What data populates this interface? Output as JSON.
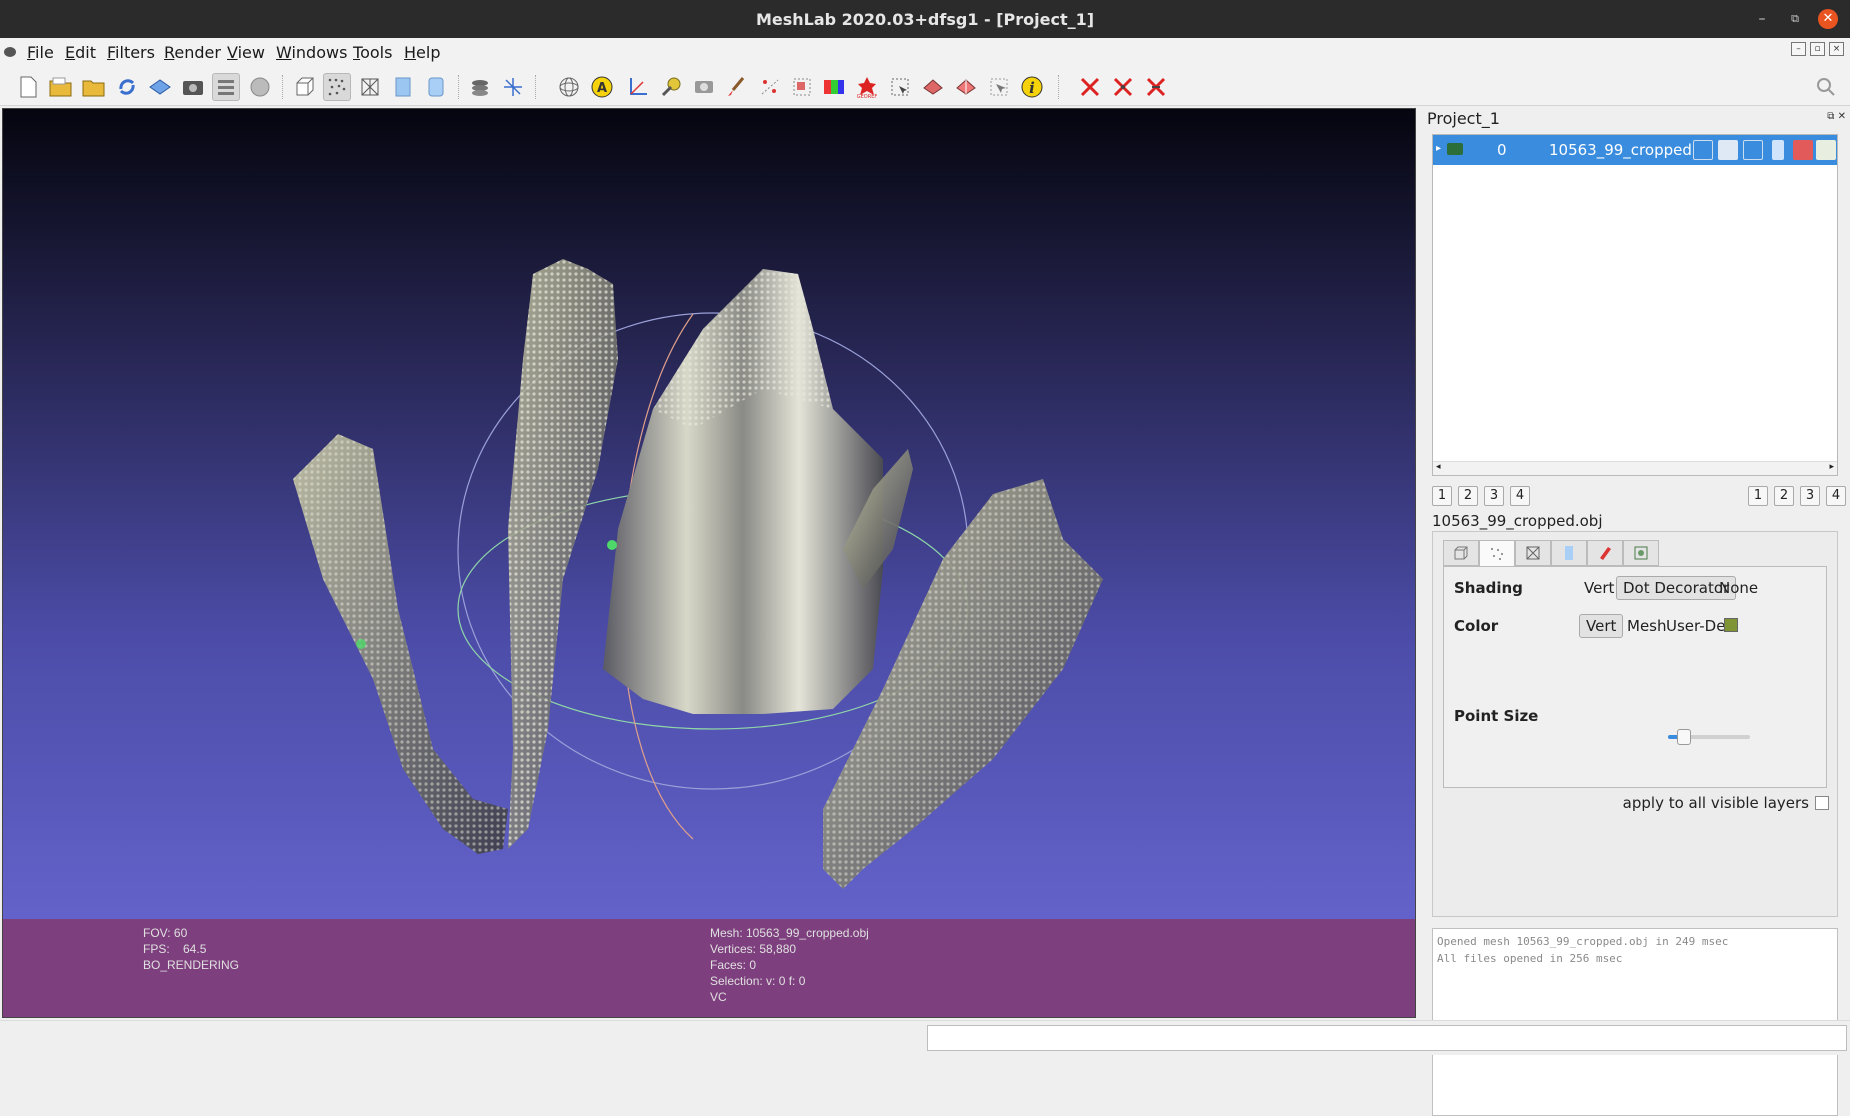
{
  "window": {
    "title": "MeshLab 2020.03+dfsg1 - [Project_1]",
    "minimize_glyph": "–",
    "restore_glyph": "⧉",
    "close_glyph": "✕"
  },
  "menubar": {
    "items": [
      {
        "label_u": "F",
        "label_rest": "ile"
      },
      {
        "label_u": "E",
        "label_rest": "dit"
      },
      {
        "label_u": "F",
        "label_rest": "ilters"
      },
      {
        "label_u": "R",
        "label_rest": "ender"
      },
      {
        "label_u": "V",
        "label_rest": "iew"
      },
      {
        "label_u": "W",
        "label_rest": "indows"
      },
      {
        "label_u": "T",
        "label_rest": "ools"
      },
      {
        "label_u": "H",
        "label_rest": "elp"
      }
    ]
  },
  "toolbar": {
    "icons": [
      "new-project-icon",
      "open-project-icon",
      "open-mesh-icon",
      "reload-icon",
      "import-raster-icon",
      "snapshot-icon",
      "layers-icon",
      "mesh-render-icon",
      "bounding-box-icon",
      "points-icon",
      "wireframe-icon",
      "flat-icon",
      "smooth-icon",
      "texture-icon",
      "axis-icon",
      "trackball-icon",
      "annotation-icon",
      "measure-icon",
      "pick-points-icon",
      "raster-icon",
      "paint-icon",
      "select-vertices-icon",
      "select-faces-icon",
      "color-icon",
      "georef-icon",
      "select-icon",
      "align-icon",
      "manipulator-icon",
      "point-picker-icon",
      "info-icon",
      "delete-icon",
      "delete-faces-icon",
      "delete-vertices-icon",
      "search-icon"
    ]
  },
  "viewport": {
    "info_left": [
      "FOV: 60",
      "FPS:    64.5",
      "BO_RENDERING"
    ],
    "info_center": [
      "Mesh: 10563_99_cropped.obj",
      "Vertices: 58,880",
      "Faces: 0",
      "Selection: v: 0 f: 0",
      "VC"
    ]
  },
  "panel": {
    "title": "Project_1",
    "layer": {
      "index": "0",
      "name": "10563_99_cropped"
    },
    "view_buttons_left": [
      "1",
      "2",
      "3",
      "4"
    ],
    "view_buttons_right": [
      "1",
      "2",
      "3",
      "4"
    ],
    "mesh_file": "10563_99_cropped.obj",
    "render_props": {
      "shading_label": "Shading",
      "shading_options": [
        "Vert",
        "Dot Decorator",
        "None"
      ],
      "shading_selected": "Dot Decorator",
      "color_label": "Color",
      "color_options": [
        "Vert",
        "Mesh",
        "User-Def"
      ],
      "color_selected": "Vert",
      "user_color": "#7f9432",
      "point_size_label": "Point Size",
      "point_size_fraction": 0.2
    },
    "apply_all_label": "apply to all visible layers",
    "log": [
      "Opened mesh 10563_99_cropped.obj in 249 msec",
      "All files opened in 256 msec"
    ]
  }
}
